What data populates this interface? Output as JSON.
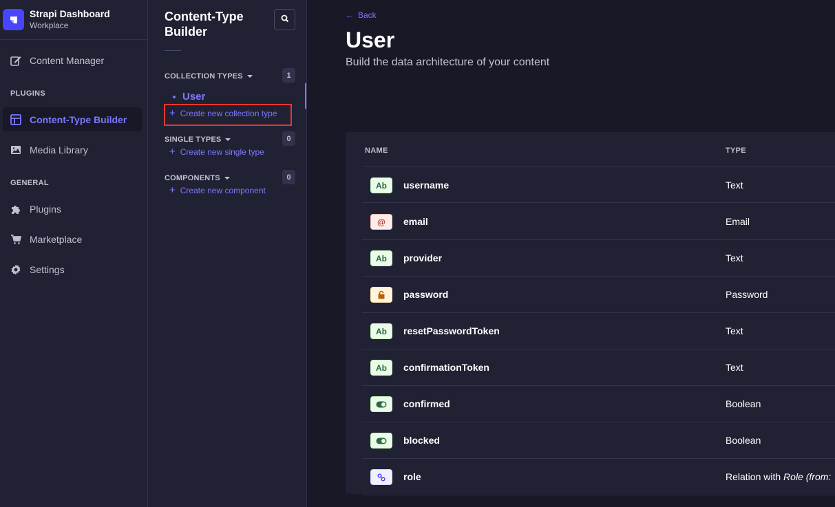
{
  "brand": {
    "title": "Strapi Dashboard",
    "subtitle": "Workplace"
  },
  "nav": {
    "content_manager": "Content Manager",
    "plugins_section": "PLUGINS",
    "content_type_builder": "Content-Type Builder",
    "media_library": "Media Library",
    "general_section": "GENERAL",
    "plugins": "Plugins",
    "marketplace": "Marketplace",
    "settings": "Settings"
  },
  "subnav": {
    "title": "Content-Type Builder",
    "collection_types": {
      "label": "COLLECTION TYPES",
      "count": "1",
      "items": [
        "User"
      ],
      "create": "Create new collection type"
    },
    "single_types": {
      "label": "SINGLE TYPES",
      "count": "0",
      "create": "Create new single type"
    },
    "components": {
      "label": "COMPONENTS",
      "count": "0",
      "create": "Create new component"
    }
  },
  "main": {
    "back": "Back",
    "title": "User",
    "subtitle": "Build the data architecture of your content",
    "columns": {
      "name": "NAME",
      "type": "TYPE"
    },
    "fields": [
      {
        "icon": "Ab",
        "name": "username",
        "type": "Text"
      },
      {
        "icon": "@",
        "name": "email",
        "type": "Email"
      },
      {
        "icon": "Ab",
        "name": "provider",
        "type": "Text"
      },
      {
        "icon": "lock-icon",
        "name": "password",
        "type": "Password"
      },
      {
        "icon": "Ab",
        "name": "resetPasswordToken",
        "type": "Text"
      },
      {
        "icon": "Ab",
        "name": "confirmationToken",
        "type": "Text"
      },
      {
        "icon": "toggle-icon",
        "name": "confirmed",
        "type": "Boolean"
      },
      {
        "icon": "toggle-icon",
        "name": "blocked",
        "type": "Boolean"
      },
      {
        "icon": "link-icon",
        "name": "role",
        "type_prefix": "Relation with ",
        "type_rel": "Role (from:"
      }
    ]
  },
  "colors": {
    "accent": "#7b79ff",
    "primary": "#4945ff",
    "highlight": "#e6372b",
    "background": "#181826",
    "panel": "#212134"
  }
}
